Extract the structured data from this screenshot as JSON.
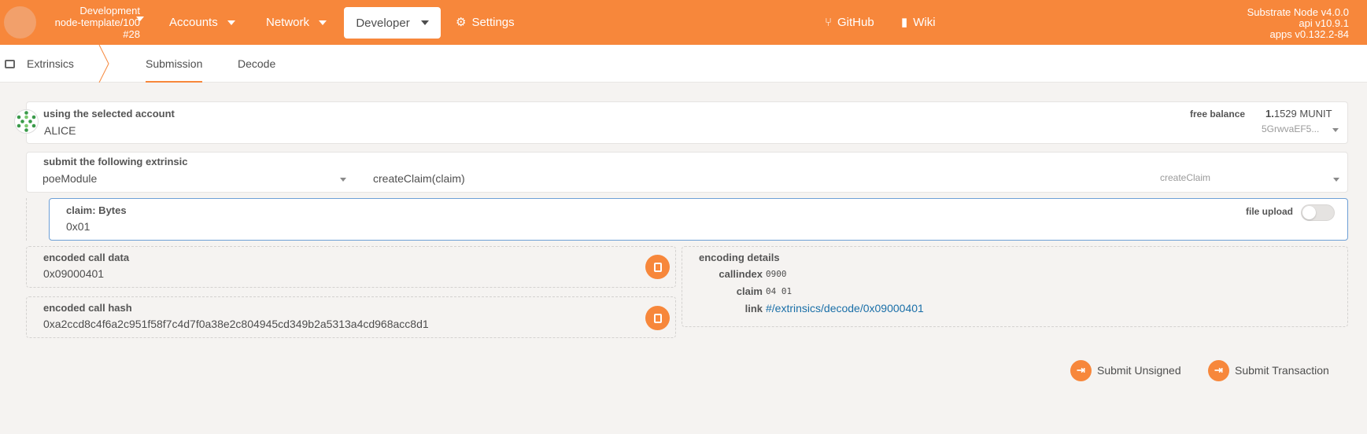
{
  "topbar": {
    "chain_name": "Development",
    "chain_spec": "node-template/100",
    "block": "#28",
    "nav": [
      {
        "label": "Accounts"
      },
      {
        "label": "Network"
      },
      {
        "label": "Developer"
      },
      {
        "label": "Settings"
      }
    ],
    "links": [
      {
        "label": "GitHub"
      },
      {
        "label": "Wiki"
      }
    ],
    "node_name": "Substrate Node v4.0.0",
    "api_version": "api v10.9.1",
    "apps_version": "apps v0.132.2-84",
    "accent": "#f7873b"
  },
  "tabsbar": {
    "section": "Extrinsics",
    "tabs": [
      {
        "label": "Submission",
        "active": true
      },
      {
        "label": "Decode",
        "active": false
      }
    ]
  },
  "account": {
    "label": "using the selected account",
    "name": "ALICE",
    "balance_label": "free balance",
    "balance_int": "1.",
    "balance_dec": "1529",
    "balance_unit": "MUNIT",
    "address": "5GrwvaEF5..."
  },
  "extrinsic": {
    "label": "submit the following extrinsic",
    "module": "poeModule",
    "method": "createClaim(claim)",
    "method_short": "createClaim"
  },
  "param": {
    "label": "claim: Bytes",
    "value": "0x01",
    "file_upload_label": "file upload",
    "file_upload_on": false
  },
  "encoded": {
    "call_data_label": "encoded call data",
    "call_data": "0x09000401",
    "call_hash_label": "encoded call hash",
    "call_hash": "0xa2ccd8c4f6a2c951f58f7c4d7f0a38e2c804945cd349b2a5313a4cd968acc8d1"
  },
  "encoding_details": {
    "title": "encoding details",
    "rows": [
      {
        "key": "callindex",
        "value": "0900"
      },
      {
        "key": "claim",
        "value": "04 01"
      },
      {
        "key": "link",
        "value": "#/extrinsics/decode/0x09000401"
      }
    ]
  },
  "actions": {
    "submit_unsigned": "Submit Unsigned",
    "submit_transaction": "Submit Transaction"
  }
}
